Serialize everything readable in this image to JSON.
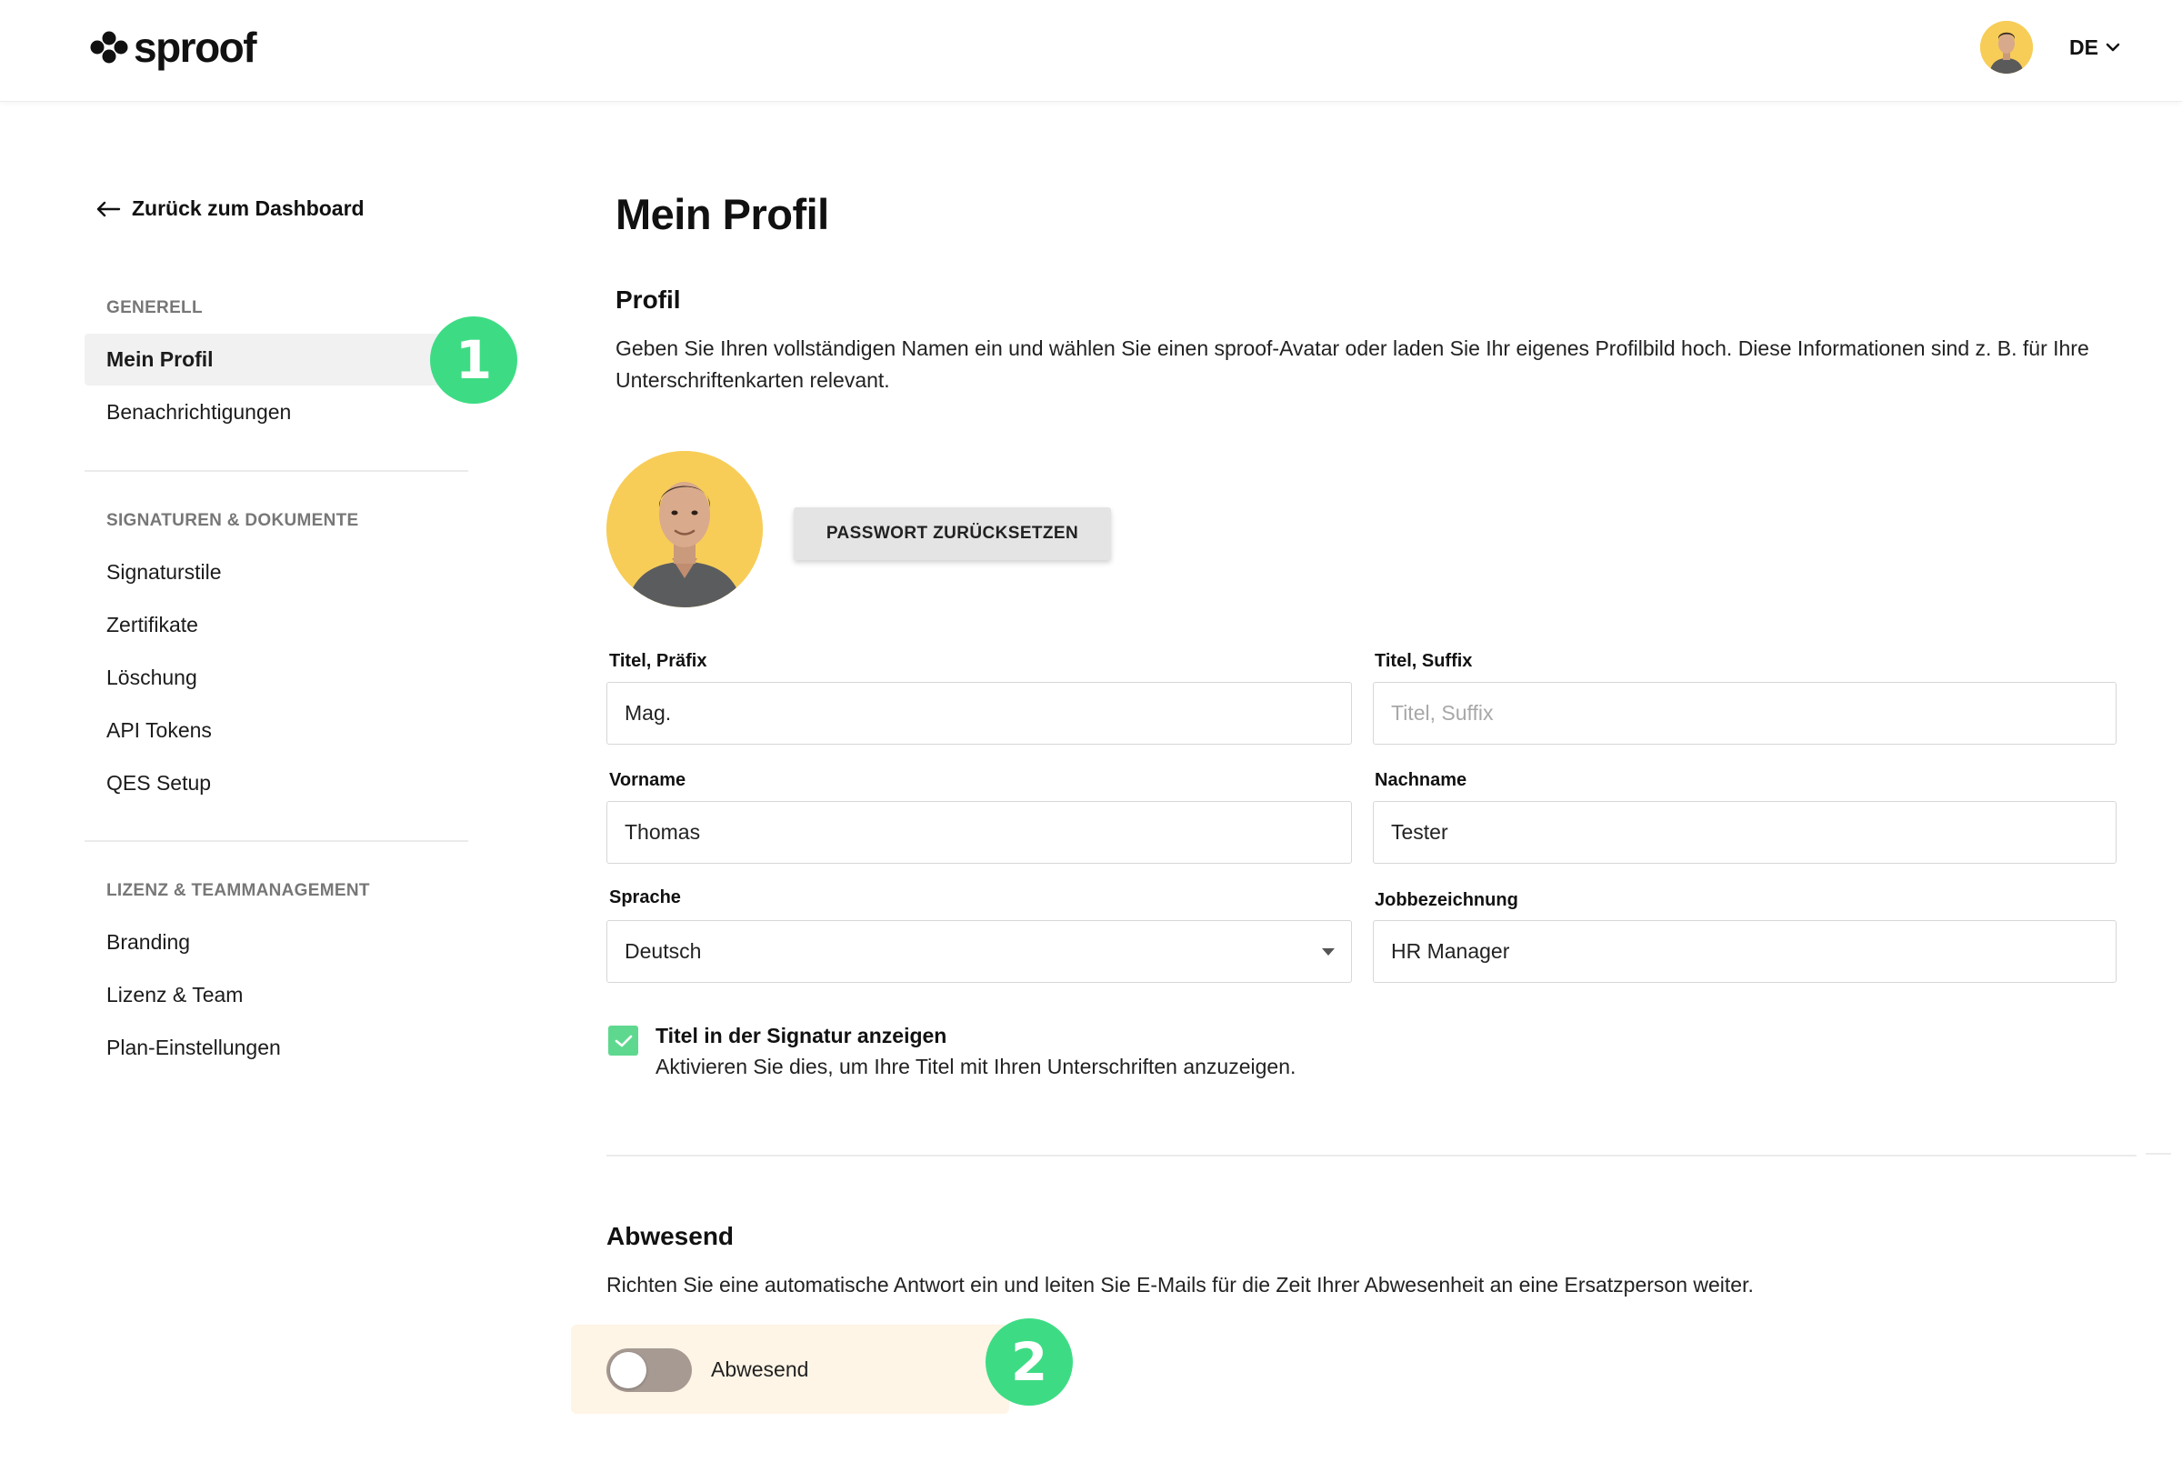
{
  "header": {
    "logo_text": "sproof",
    "language": "DE"
  },
  "sidebar": {
    "back_label": "Zurück zum Dashboard",
    "sections": [
      {
        "title": "GENERELL",
        "items": [
          {
            "label": "Mein Profil",
            "active": true
          },
          {
            "label": "Benachrichtigungen",
            "active": false
          }
        ]
      },
      {
        "title": "SIGNATUREN & DOKUMENTE",
        "items": [
          {
            "label": "Signaturstile"
          },
          {
            "label": "Zertifikate"
          },
          {
            "label": "Löschung"
          },
          {
            "label": "API Tokens"
          },
          {
            "label": "QES Setup"
          }
        ]
      },
      {
        "title": "LIZENZ & TEAMMANAGEMENT",
        "items": [
          {
            "label": "Branding"
          },
          {
            "label": "Lizenz & Team"
          },
          {
            "label": "Plan-Einstellungen"
          }
        ]
      }
    ]
  },
  "annotations": {
    "badge_1": "1",
    "badge_2": "2",
    "badge_color": "#3ddc84"
  },
  "main": {
    "page_title": "Mein Profil",
    "profile": {
      "heading": "Profil",
      "description": "Geben Sie Ihren vollständigen Namen ein und wählen Sie einen sproof-Avatar oder laden Sie Ihr eigenes Profilbild hoch. Diese Informationen sind z. B. für Ihre Unterschriftenkarten relevant.",
      "reset_password_label": "PASSWORT ZURÜCKSETZEN"
    },
    "form": {
      "title_prefix": {
        "label": "Titel, Präfix",
        "value": "Mag."
      },
      "title_suffix": {
        "label": "Titel, Suffix",
        "placeholder": "Titel, Suffix"
      },
      "first_name": {
        "label": "Vorname",
        "value": "Thomas"
      },
      "last_name": {
        "label": "Nachname",
        "value": "Tester"
      },
      "language": {
        "label": "Sprache",
        "value": "Deutsch"
      },
      "job_title": {
        "label": "Jobbezeichnung",
        "value": "HR Manager"
      },
      "show_title": {
        "checked": true,
        "label": "Titel in der Signatur anzeigen",
        "description": "Aktivieren Sie dies, um Ihre Titel mit Ihren Unterschriften anzuzeigen."
      }
    },
    "absent": {
      "heading": "Abwesend",
      "description": "Richten Sie eine automatische Antwort ein und leiten Sie E-Mails für die Zeit Ihrer Abwesenheit an eine Ersatzperson weiter.",
      "toggle_label": "Abwesend",
      "toggle_on": false
    }
  },
  "colors": {
    "accent_green": "#3ddc84",
    "checkbox_green": "#5fd88f",
    "avatar_yellow": "#f7cd58",
    "absent_highlight": "#fff5e6"
  }
}
